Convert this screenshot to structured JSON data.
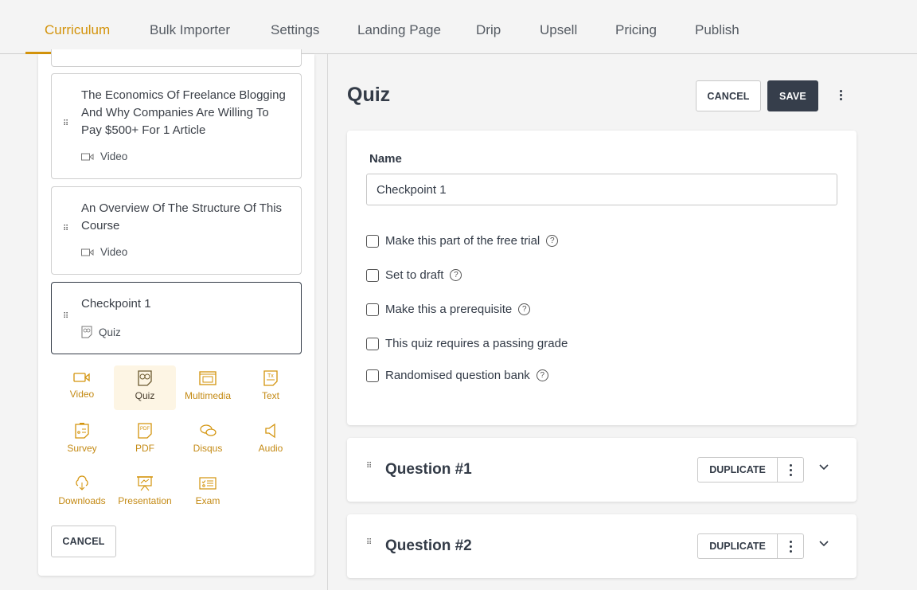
{
  "tabs": [
    {
      "label": "Curriculum",
      "active": true
    },
    {
      "label": "Bulk Importer",
      "active": false
    },
    {
      "label": "Settings",
      "active": false
    },
    {
      "label": "Landing Page",
      "active": false
    },
    {
      "label": "Drip",
      "active": false
    },
    {
      "label": "Upsell",
      "active": false
    },
    {
      "label": "Pricing",
      "active": false
    },
    {
      "label": "Publish",
      "active": false
    }
  ],
  "accent_color": "#d3930b",
  "lessons": [
    {
      "title": "The Economics Of Freelance Blogging And Why Companies Are Willing To Pay $500+ For 1 Article",
      "type": "Video",
      "icon": "video-icon"
    },
    {
      "title": "An Overview Of The Structure Of This Course",
      "type": "Video",
      "icon": "video-icon"
    },
    {
      "title": "Checkpoint 1",
      "type": "Quiz",
      "icon": "quiz-icon",
      "selected": true
    }
  ],
  "lesson_types": [
    {
      "label": "Video",
      "icon": "video-icon"
    },
    {
      "label": "Quiz",
      "icon": "quiz-icon",
      "active": true
    },
    {
      "label": "Multimedia",
      "icon": "multimedia-icon"
    },
    {
      "label": "Text",
      "icon": "text-icon"
    },
    {
      "label": "Survey",
      "icon": "survey-icon"
    },
    {
      "label": "PDF",
      "icon": "pdf-icon"
    },
    {
      "label": "Disqus",
      "icon": "disqus-icon"
    },
    {
      "label": "Audio",
      "icon": "audio-icon"
    },
    {
      "label": "Downloads",
      "icon": "downloads-icon"
    },
    {
      "label": "Presentation",
      "icon": "presentation-icon"
    },
    {
      "label": "Exam",
      "icon": "exam-icon"
    }
  ],
  "left_cancel_label": "CANCEL",
  "editor": {
    "title": "Quiz",
    "cancel_label": "CANCEL",
    "save_label": "SAVE",
    "name_label": "Name",
    "name_value": "Checkpoint 1",
    "options": [
      {
        "label": "Make this part of the free trial",
        "checked": false,
        "help": true
      },
      {
        "label": "Set to draft",
        "checked": false,
        "help": true
      },
      {
        "label": "Make this a prerequisite",
        "checked": false,
        "help": true
      },
      {
        "label": "This quiz requires a passing grade",
        "checked": false,
        "help": false
      },
      {
        "label": "Randomised question bank",
        "checked": false,
        "help": true
      }
    ],
    "help_glyph": "?"
  },
  "questions": [
    {
      "title": "Question #1",
      "duplicate_label": "DUPLICATE"
    },
    {
      "title": "Question #2",
      "duplicate_label": "DUPLICATE"
    }
  ],
  "grip_glyph": "⋮⋮"
}
